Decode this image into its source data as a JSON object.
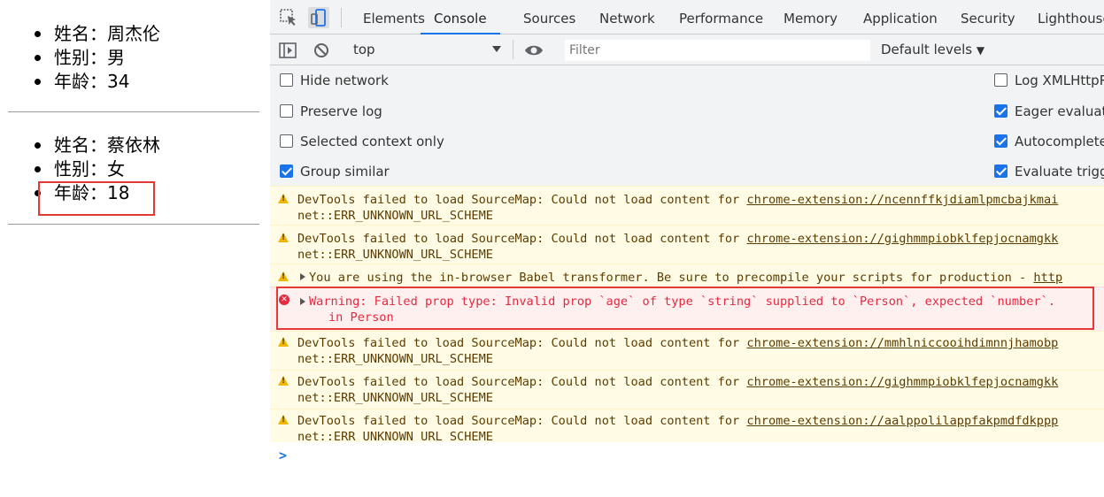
{
  "persons": [
    {
      "name": "姓名：周杰伦",
      "gender": "性别：男",
      "age": "年龄：34"
    },
    {
      "name": "姓名：蔡依林",
      "gender": "性别：女",
      "age": "年龄：18"
    }
  ],
  "devtools": {
    "tabs": [
      "Elements",
      "Console",
      "Sources",
      "Network",
      "Performance",
      "Memory",
      "Application",
      "Security",
      "Lighthouse"
    ],
    "active_tab": "Console",
    "context": "top",
    "filter_placeholder": "Filter",
    "levels": "Default levels",
    "settings_left": [
      {
        "label": "Hide network",
        "checked": false
      },
      {
        "label": "Preserve log",
        "checked": false
      },
      {
        "label": "Selected context only",
        "checked": false
      },
      {
        "label": "Group similar",
        "checked": true
      }
    ],
    "settings_right": [
      {
        "label": "Log XMLHttpRequests",
        "checked": false
      },
      {
        "label": "Eager evaluation",
        "checked": true
      },
      {
        "label": "Autocomplete from history",
        "checked": true
      },
      {
        "label": "Evaluate triggers user activation",
        "checked": true
      }
    ],
    "messages": [
      {
        "type": "warn",
        "text": "DevTools failed to load SourceMap: Could not load content for ",
        "link": "chrome-extension://ncennffkjdiamlpmcbajkmai",
        "line2": "net::ERR_UNKNOWN_URL_SCHEME"
      },
      {
        "type": "warn",
        "text": "DevTools failed to load SourceMap: Could not load content for ",
        "link": "chrome-extension://gighmmpiobklfepjocnamgkk",
        "line2": "net::ERR_UNKNOWN_URL_SCHEME"
      },
      {
        "type": "warn-expand",
        "text": "You are using the in-browser Babel transformer. Be sure to precompile your scripts for production - ",
        "link": "http"
      },
      {
        "type": "err",
        "text": "Warning: Failed prop type: Invalid prop `age` of type `string` supplied to `Person`, expected `number`.",
        "line2": "in Person"
      },
      {
        "type": "warn",
        "text": "DevTools failed to load SourceMap: Could not load content for ",
        "link": "chrome-extension://mmhlniccooihdimnnjhamobp",
        "line2": "net::ERR_UNKNOWN_URL_SCHEME"
      },
      {
        "type": "warn",
        "text": "DevTools failed to load SourceMap: Could not load content for ",
        "link": "chrome-extension://gighmmpiobklfepjocnamgkk",
        "line2": "net::ERR_UNKNOWN_URL_SCHEME"
      },
      {
        "type": "warn",
        "text": "DevTools failed to load SourceMap: Could not load content for ",
        "link": "chrome-extension://aalppolilappfakpmdfdkppp",
        "line2": "net::ERR_UNKNOWN_URL_SCHEME"
      }
    ],
    "prompt": ">"
  },
  "colors": {
    "accent": "#1a73e8",
    "highlight_box": "#e53935",
    "warning_bg": "#fffbe5",
    "error_text": "#e5293f"
  }
}
